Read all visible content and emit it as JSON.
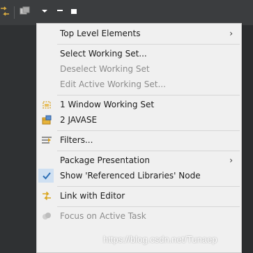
{
  "menu": {
    "items": [
      {
        "label": "Top Level Elements",
        "has_submenu": true,
        "enabled": true
      },
      {
        "label": "Select Working Set...",
        "enabled": true
      },
      {
        "label": "Deselect Working Set",
        "enabled": false
      },
      {
        "label": "Edit Active Working Set...",
        "enabled": false
      },
      {
        "label": "1 Window Working Set",
        "enabled": true,
        "icon": "window-working-set-icon"
      },
      {
        "label": "2 JAVASE",
        "enabled": true,
        "icon": "working-set-icon"
      },
      {
        "label": "Filters...",
        "enabled": true,
        "icon": "filters-icon"
      },
      {
        "label": "Package Presentation",
        "has_submenu": true,
        "enabled": true
      },
      {
        "label": "Show 'Referenced Libraries' Node",
        "enabled": true,
        "checked": true
      },
      {
        "label": "Link with Editor",
        "enabled": true,
        "icon": "link-with-editor-icon"
      },
      {
        "label": "Focus on Active Task",
        "enabled": false,
        "icon": "focus-task-icon"
      }
    ],
    "submenu_arrow": "›"
  },
  "watermark": "https://blog.csdn.net/Tunaep",
  "colors": {
    "menu_bg": "#f0f0f0",
    "check_highlight": "#cfe0f2",
    "check_mark": "#2d6fb5",
    "disabled_text": "#8c8c8c",
    "toolbar_bg": "#3b3d3f"
  }
}
